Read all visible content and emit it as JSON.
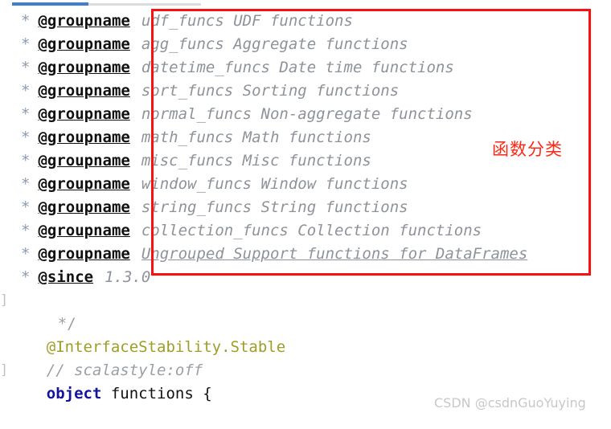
{
  "editor": {
    "scrollbar": {
      "accent_color": "#3f7fd0",
      "track_color": "#dcdcdc"
    },
    "comment_star": "*",
    "doc_lines": [
      {
        "tag": "@groupname",
        "desc": "udf_funcs UDF functions",
        "underlined": false
      },
      {
        "tag": "@groupname",
        "desc": "agg_funcs Aggregate functions",
        "underlined": false
      },
      {
        "tag": "@groupname",
        "desc": "datetime_funcs Date time functions",
        "underlined": false
      },
      {
        "tag": "@groupname",
        "desc": "sort_funcs Sorting functions",
        "underlined": false
      },
      {
        "tag": "@groupname",
        "desc": "normal_funcs Non-aggregate functions",
        "underlined": false
      },
      {
        "tag": "@groupname",
        "desc": "math_funcs Math functions",
        "underlined": false
      },
      {
        "tag": "@groupname",
        "desc": "misc_funcs Misc functions",
        "underlined": false
      },
      {
        "tag": "@groupname",
        "desc": "window_funcs Window functions",
        "underlined": false
      },
      {
        "tag": "@groupname",
        "desc": "string_funcs String functions",
        "underlined": false
      },
      {
        "tag": "@groupname",
        "desc": "collection_funcs Collection functions",
        "underlined": false
      },
      {
        "tag": "@groupname",
        "desc": "Ungrouped Support functions for DataFrames",
        "underlined": true
      },
      {
        "tag": "@since",
        "desc": "1.3.0",
        "underlined": false
      }
    ],
    "comment_close": "*/",
    "annotation_line": "@InterfaceStability.Stable",
    "scalastyle_comment": "// scalastyle:off",
    "object_keyword": "object",
    "object_rest": " functions {",
    "fold_marker": "]"
  },
  "annotations": {
    "box_color": "#fb0f0f",
    "chinese_note": "函数分类"
  },
  "watermark": {
    "text": "CSDN @csdnGuoYuying"
  }
}
